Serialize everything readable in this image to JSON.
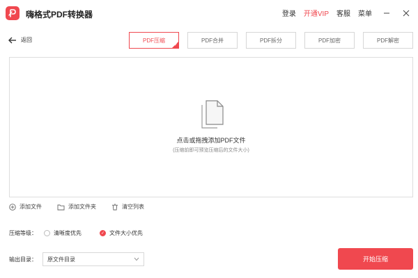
{
  "app": {
    "title": "嗨格式PDF转换器",
    "brand_color": "#f0484f",
    "logo_icon": "pdf-p-logo-icon"
  },
  "top_menu": {
    "login": "登录",
    "vip": "开通VIP",
    "service": "客服",
    "menu": "菜单",
    "minimize_icon": "minimize-icon",
    "close_icon": "close-icon"
  },
  "nav": {
    "back_label": "返回",
    "back_icon": "arrow-left-icon"
  },
  "tabs": [
    {
      "label": "PDF压缩",
      "active": true
    },
    {
      "label": "PDF合并",
      "active": false
    },
    {
      "label": "PDF拆分",
      "active": false
    },
    {
      "label": "PDF加密",
      "active": false
    },
    {
      "label": "PDF解密",
      "active": false
    }
  ],
  "dropzone": {
    "icon": "documents-icon",
    "title": "点击或拖拽添加PDF文件",
    "subtitle": "(压缩前即可预览压缩后的文件大小)"
  },
  "actions": {
    "add_file": "添加文件",
    "add_folder": "添加文件夹",
    "clear_list": "清空列表"
  },
  "compression": {
    "label": "压缩等级：",
    "options": [
      {
        "label": "清晰度优先",
        "checked": false
      },
      {
        "label": "文件大小优先",
        "checked": true
      }
    ]
  },
  "output": {
    "label": "输出目录：",
    "value": "原文件目录",
    "icon": "chevron-down-icon"
  },
  "start_button": "开始压缩"
}
